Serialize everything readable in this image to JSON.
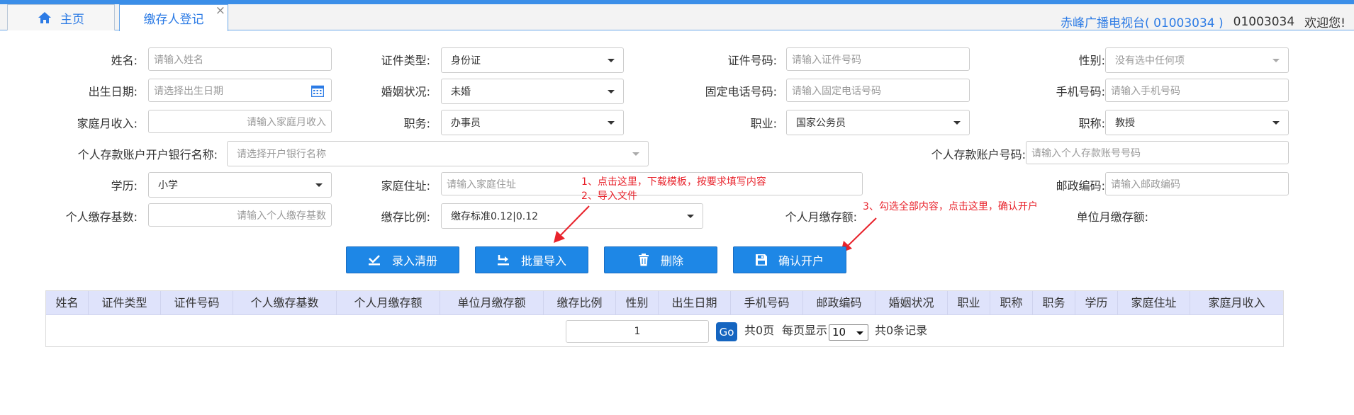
{
  "tabs": {
    "home_label": "主页",
    "active_label": "缴存人登记",
    "close_symbol": "×"
  },
  "user": {
    "station": "赤峰广播电视台( 01003034 )",
    "uid": "01003034",
    "welcome": "欢迎您!"
  },
  "form": {
    "name": {
      "label": "姓名:",
      "placeholder": "请输入姓名"
    },
    "id_type": {
      "label": "证件类型:",
      "value": "身份证"
    },
    "id_number": {
      "label": "证件号码:",
      "placeholder": "请输入证件号码"
    },
    "gender": {
      "label": "性别:",
      "placeholder": "没有选中任何项"
    },
    "birth_date": {
      "label": "出生日期:",
      "placeholder": "请选择出生日期"
    },
    "marital": {
      "label": "婚姻状况:",
      "value": "未婚"
    },
    "landline": {
      "label": "固定电话号码:",
      "placeholder": "请输入固定电话号码"
    },
    "mobile": {
      "label": "手机号码:",
      "placeholder": "请输入手机号码"
    },
    "family_income": {
      "label": "家庭月收入:",
      "placeholder": "请输入家庭月收入"
    },
    "duty": {
      "label": "职务:",
      "value": "办事员"
    },
    "occupation": {
      "label": "职业:",
      "value": "国家公务员"
    },
    "title": {
      "label": "职称:",
      "value": "教授"
    },
    "bank_name": {
      "label": "个人存款账户开户银行名称:",
      "placeholder": "请选择开户银行名称"
    },
    "bank_account": {
      "label": "个人存款账户号码:",
      "placeholder": "请输入个人存款账号号码"
    },
    "education": {
      "label": "学历:",
      "value": "小学"
    },
    "address": {
      "label": "家庭住址:",
      "placeholder": "请输入家庭住址"
    },
    "postcode": {
      "label": "邮政编码:",
      "placeholder": "请输入邮政编码"
    },
    "base": {
      "label": "个人缴存基数:",
      "placeholder": "请输入个人缴存基数"
    },
    "ratio": {
      "label": "缴存比例:",
      "value": "缴存标准0.12|0.12"
    },
    "personal_monthly": {
      "label": "个人月缴存额:"
    },
    "unit_monthly": {
      "label": "单位月缴存额:"
    }
  },
  "buttons": {
    "clear": "录入清册",
    "batch_import": "批量导入",
    "delete": "删除",
    "confirm": "确认开户"
  },
  "annotations": {
    "note1": "1、点击这里，下载模板，按要求填写内容",
    "note2": "2、导入文件",
    "note3": "3、勾选全部内容，点击这里，确认开户"
  },
  "table": {
    "columns": [
      "姓名",
      "证件类型",
      "证件号码",
      "个人缴存基数",
      "个人月缴存额",
      "单位月缴存额",
      "缴存比例",
      "性别",
      "出生日期",
      "手机号码",
      "邮政编码",
      "婚姻状况",
      "职业",
      "职称",
      "职务",
      "学历",
      "家庭住址",
      "家庭月收入"
    ]
  },
  "pager": {
    "page": "1",
    "go": "Go",
    "total_pages": "共0页",
    "per_page_label": "每页显示",
    "per_page": "10",
    "total_records": "共0条记录"
  },
  "colors": {
    "accent": "#1e87e6",
    "annotation": "#e8222b",
    "table_header": "#dfe3fb"
  }
}
